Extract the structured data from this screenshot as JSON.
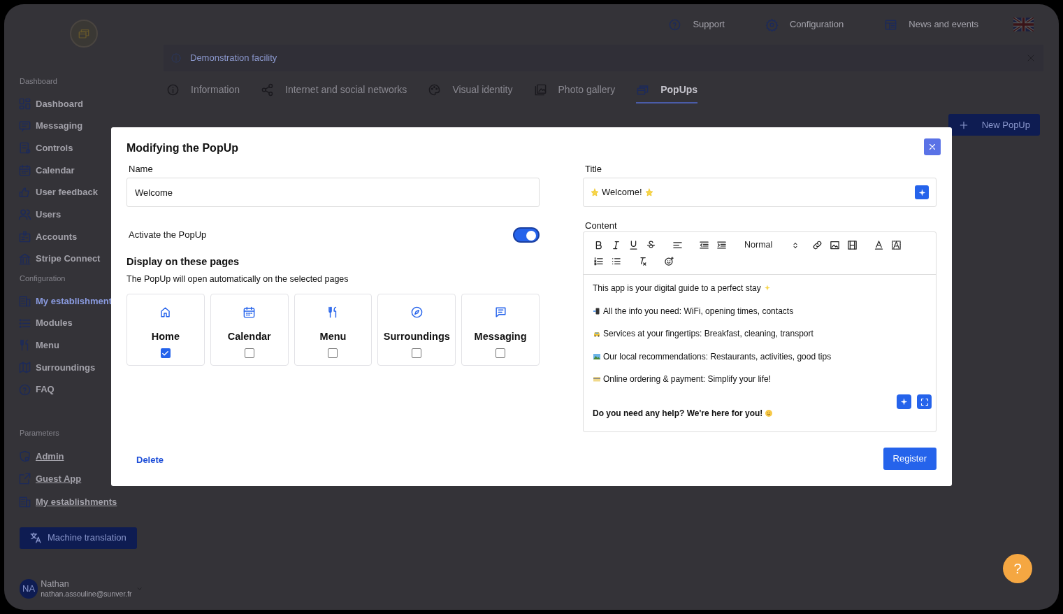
{
  "topbar": {
    "items": [
      {
        "label": "Support"
      },
      {
        "label": "Configuration"
      },
      {
        "label": "News and events"
      }
    ]
  },
  "sidebar": {
    "sections": [
      {
        "title": "Dashboard",
        "items": [
          {
            "label": "Dashboard",
            "selected": false
          },
          {
            "label": "Messaging",
            "selected": false
          },
          {
            "label": "Controls",
            "selected": false
          },
          {
            "label": "Calendar",
            "selected": false
          },
          {
            "label": "User feedback",
            "selected": false
          },
          {
            "label": "Users",
            "selected": false
          },
          {
            "label": "Accounts",
            "selected": false
          },
          {
            "label": "Stripe Connect",
            "selected": false
          }
        ]
      },
      {
        "title": "Configuration",
        "items": [
          {
            "label": "My establishment",
            "selected": true
          },
          {
            "label": "Modules",
            "selected": false
          },
          {
            "label": "Menu",
            "selected": false
          },
          {
            "label": "Surroundings",
            "selected": false
          },
          {
            "label": "FAQ",
            "selected": false
          }
        ]
      },
      {
        "title": "Parameters",
        "links": [
          {
            "label": "Admin"
          },
          {
            "label": "Guest App"
          },
          {
            "label": "My establishments"
          }
        ]
      }
    ],
    "translate_button": "Machine translation",
    "user": {
      "initials": "NA",
      "name": "Nathan",
      "email": "nathan.assouline@sunver.fr"
    }
  },
  "banner": {
    "text": "Demonstration facility"
  },
  "tabs": [
    {
      "label": "Information",
      "selected": false
    },
    {
      "label": "Internet and social networks",
      "selected": false
    },
    {
      "label": "Visual identity",
      "selected": false
    },
    {
      "label": "Photo gallery",
      "selected": false
    },
    {
      "label": "PopUps",
      "selected": true
    }
  ],
  "new_button": "New PopUp",
  "modal": {
    "title": "Modifying the PopUp",
    "name": {
      "label": "Name",
      "value": "Welcome"
    },
    "activate": {
      "label": "Activate the PopUp",
      "on": true
    },
    "pages": {
      "title": "Display on these pages",
      "description": "The PopUp will open automatically on the selected pages",
      "items": [
        {
          "label": "Home",
          "checked": true
        },
        {
          "label": "Calendar",
          "checked": false
        },
        {
          "label": "Menu",
          "checked": false
        },
        {
          "label": "Surroundings",
          "checked": false
        },
        {
          "label": "Messaging",
          "checked": false
        }
      ]
    },
    "title_field": {
      "label": "Title",
      "value": "Welcome!"
    },
    "content": {
      "label": "Content",
      "format": "Normal",
      "lines": [
        {
          "text": "This app is your digital guide to a perfect stay",
          "bold": false
        },
        {
          "text": "All the info you need: WiFi, opening times, contacts",
          "bold": false
        },
        {
          "text": "Services at your fingertips: Breakfast, cleaning, transport",
          "bold": false
        },
        {
          "text": "Our local recommendations: Restaurants, activities, good tips",
          "bold": false
        },
        {
          "text": "Online ordering & payment: Simplify your life!",
          "bold": false
        },
        {
          "text": "Do you need any help? We're here for you!",
          "bold": true
        }
      ]
    },
    "delete": "Delete",
    "register": "Register"
  },
  "help_button": "?"
}
